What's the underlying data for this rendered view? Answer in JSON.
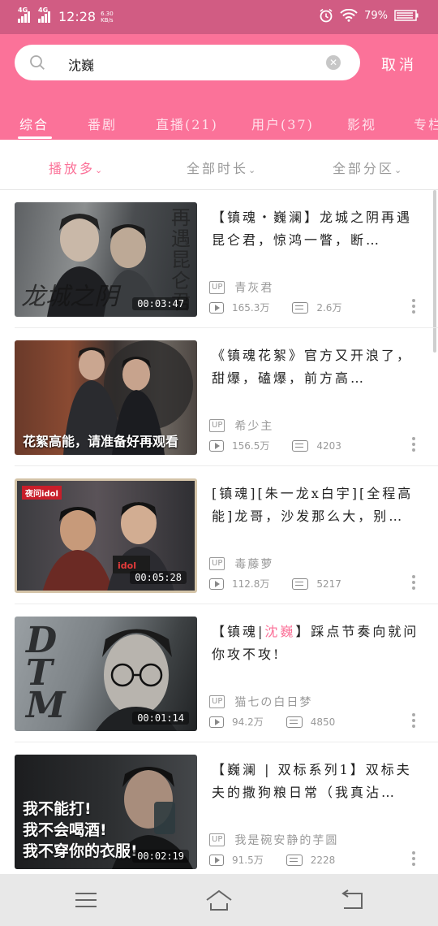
{
  "status_bar": {
    "signal_1": "4G",
    "signal_2": "4G",
    "time": "12:28",
    "speed_value": "6.30",
    "speed_unit": "KB/s",
    "battery": "79%",
    "colors": {
      "bar": "#d15c83"
    }
  },
  "search": {
    "query": "沈巍",
    "cancel_label": "取消"
  },
  "tabs": [
    {
      "label": "综合",
      "active": true
    },
    {
      "label": "番剧"
    },
    {
      "label": "直播(21)"
    },
    {
      "label": "用户(37)"
    },
    {
      "label": "影视"
    },
    {
      "label": "专栏"
    }
  ],
  "filters": [
    {
      "label": "播放多",
      "active": true
    },
    {
      "label": "全部时长"
    },
    {
      "label": "全部分区"
    }
  ],
  "videos": [
    {
      "title": "【镇魂・巍澜】龙城之阴再遇昆仑君，惊鸿一瞥，断…",
      "uploader": "青灰君",
      "views": "165.3万",
      "danmaku": "2.6万",
      "duration": "00:03:47",
      "thumb_text": "龙城之阴",
      "thumb_text_2": "再遇昆仑君"
    },
    {
      "title": "《镇魂花絮》官方又开浪了，甜爆，磕爆，前方高…",
      "uploader": "希少主",
      "views": "156.5万",
      "danmaku": "4203",
      "duration": "",
      "thumb_text": "花絮高能，请准备好再观看"
    },
    {
      "title": "[镇魂][朱一龙x白宇][全程高能]龙哥，沙发那么大，别…",
      "uploader": "毒藤萝",
      "views": "112.8万",
      "danmaku": "5217",
      "duration": "00:05:28",
      "thumb_text": "夜问idol"
    },
    {
      "title_pre": "【镇魂|",
      "title_hl": "沈巍",
      "title_post": "】踩点节奏向就问你攻不攻!",
      "uploader": "猫七の白日梦",
      "views": "94.2万",
      "danmaku": "4850",
      "duration": "00:01:14",
      "thumb_text": "DTM"
    },
    {
      "title": "【巍澜 | 双标系列1】双标夫夫的撒狗粮日常（我真沾…",
      "uploader": "我是碗安静的芋圆",
      "views": "91.5万",
      "danmaku": "2228",
      "duration": "00:02:19",
      "thumb_text": "我不能打!\n我不会喝酒!\n我不穿你的衣服!"
    }
  ],
  "colors": {
    "accent": "#fb7299",
    "header": "#fb7299"
  }
}
